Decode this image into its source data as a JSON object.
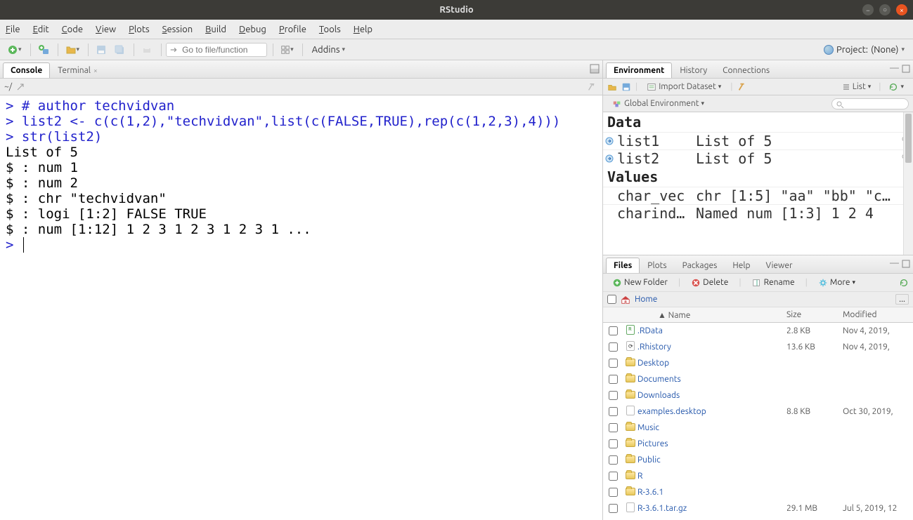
{
  "window": {
    "title": "RStudio"
  },
  "menu": {
    "file": "File",
    "edit": "Edit",
    "code": "Code",
    "view": "View",
    "plots": "Plots",
    "session": "Session",
    "build": "Build",
    "debug": "Debug",
    "profile": "Profile",
    "tools": "Tools",
    "help": "Help"
  },
  "toolbar": {
    "goto_placeholder": "Go to file/function",
    "addins_label": "Addins",
    "project_prefix": "Project:",
    "project_value": "(None)"
  },
  "console": {
    "tab_console": "Console",
    "tab_terminal": "Terminal",
    "path": "~/",
    "lines": [
      {
        "type": "prompt",
        "text": "> "
      },
      {
        "type": "code",
        "text": "# author techvidvan"
      },
      {
        "type": "break"
      },
      {
        "type": "prompt",
        "text": "> "
      },
      {
        "type": "code",
        "text": "list2 <- c(c(1,2),\"techvidvan\",list(c(FALSE,TRUE),rep(c(1,2,3),4)))"
      },
      {
        "type": "break"
      },
      {
        "type": "prompt",
        "text": "> "
      },
      {
        "type": "code",
        "text": "str(list2)"
      },
      {
        "type": "break"
      },
      {
        "type": "output",
        "text": "List of 5"
      },
      {
        "type": "break"
      },
      {
        "type": "output",
        "text": " $ : num 1"
      },
      {
        "type": "break"
      },
      {
        "type": "output",
        "text": " $ : num 2"
      },
      {
        "type": "break"
      },
      {
        "type": "output",
        "text": " $ : chr \"techvidvan\""
      },
      {
        "type": "break"
      },
      {
        "type": "output",
        "text": " $ : logi [1:2] FALSE TRUE"
      },
      {
        "type": "break"
      },
      {
        "type": "output",
        "text": " $ : num [1:12] 1 2 3 1 2 3 1 2 3 1 ..."
      },
      {
        "type": "break"
      },
      {
        "type": "prompt",
        "text": "> "
      },
      {
        "type": "cursor"
      }
    ]
  },
  "env": {
    "tab_env": "Environment",
    "tab_history": "History",
    "tab_conn": "Connections",
    "import_label": "Import Dataset",
    "list_label": "List",
    "scope_label": "Global Environment",
    "search_placeholder": "",
    "section_data": "Data",
    "section_values": "Values",
    "rows_data": [
      {
        "name": "list1",
        "value": "List of 5"
      },
      {
        "name": "list2",
        "value": "List of 5"
      }
    ],
    "rows_values": [
      {
        "name": "char_vec",
        "value": "chr [1:5] \"aa\" \"bb\" \"c…"
      },
      {
        "name": "charind…",
        "value": "Named num [1:3] 1 2 4"
      }
    ]
  },
  "files": {
    "tab_files": "Files",
    "tab_plots": "Plots",
    "tab_packages": "Packages",
    "tab_help": "Help",
    "tab_viewer": "Viewer",
    "new_folder": "New Folder",
    "delete": "Delete",
    "rename": "Rename",
    "more": "More",
    "breadcrumb_home": "Home",
    "col_name": "Name",
    "col_size": "Size",
    "col_mod": "Modified",
    "rows": [
      {
        "icon": "rdata",
        "name": ".RData",
        "size": "2.8 KB",
        "mod": "Nov 4, 2019,"
      },
      {
        "icon": "rhist",
        "name": ".Rhistory",
        "size": "13.6 KB",
        "mod": "Nov 4, 2019,"
      },
      {
        "icon": "folder",
        "name": "Desktop",
        "size": "",
        "mod": ""
      },
      {
        "icon": "folder",
        "name": "Documents",
        "size": "",
        "mod": ""
      },
      {
        "icon": "folder",
        "name": "Downloads",
        "size": "",
        "mod": ""
      },
      {
        "icon": "file",
        "name": "examples.desktop",
        "size": "8.8 KB",
        "mod": "Oct 30, 2019,"
      },
      {
        "icon": "folder",
        "name": "Music",
        "size": "",
        "mod": ""
      },
      {
        "icon": "folder",
        "name": "Pictures",
        "size": "",
        "mod": ""
      },
      {
        "icon": "folder-public",
        "name": "Public",
        "size": "",
        "mod": ""
      },
      {
        "icon": "folder",
        "name": "R",
        "size": "",
        "mod": ""
      },
      {
        "icon": "folder",
        "name": "R-3.6.1",
        "size": "",
        "mod": ""
      },
      {
        "icon": "file",
        "name": "R-3.6.1.tar.gz",
        "size": "29.1 MB",
        "mod": "Jul 5, 2019, 12"
      }
    ]
  }
}
